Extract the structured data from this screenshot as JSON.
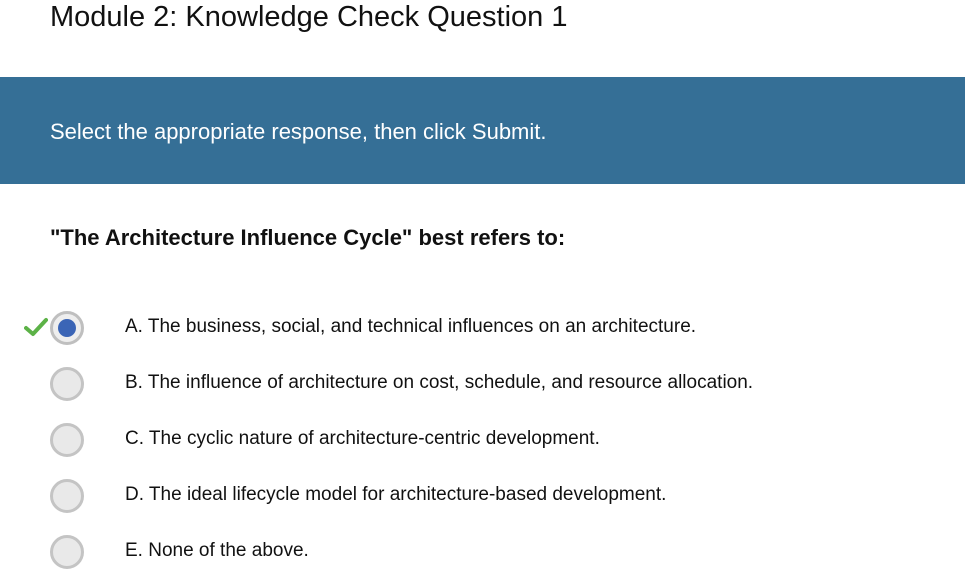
{
  "page": {
    "title": "Module 2: Knowledge Check Question 1"
  },
  "banner": {
    "instruction": "Select the appropriate response, then click Submit.",
    "color": "#356f96"
  },
  "question": {
    "prompt": "\"The Architecture Influence Cycle\" best refers to:"
  },
  "options": [
    {
      "label": "A. The business, social, and technical influences on an architecture.",
      "selected": true,
      "marked_correct": true
    },
    {
      "label": "B. The influence of architecture on cost, schedule, and resource allocation.",
      "selected": false,
      "marked_correct": false
    },
    {
      "label": "C. The cyclic nature of architecture-centric development.",
      "selected": false,
      "marked_correct": false
    },
    {
      "label": "D. The ideal lifecycle model for architecture-based development.",
      "selected": false,
      "marked_correct": false
    },
    {
      "label": "E. None of the above.",
      "selected": false,
      "marked_correct": false
    }
  ],
  "icons": {
    "correct_marker": "checkmark-icon",
    "radio": "radio-button-icon"
  },
  "colors": {
    "checkmark": "#5cb247",
    "radio_selected_dot": "#3b65b6"
  }
}
